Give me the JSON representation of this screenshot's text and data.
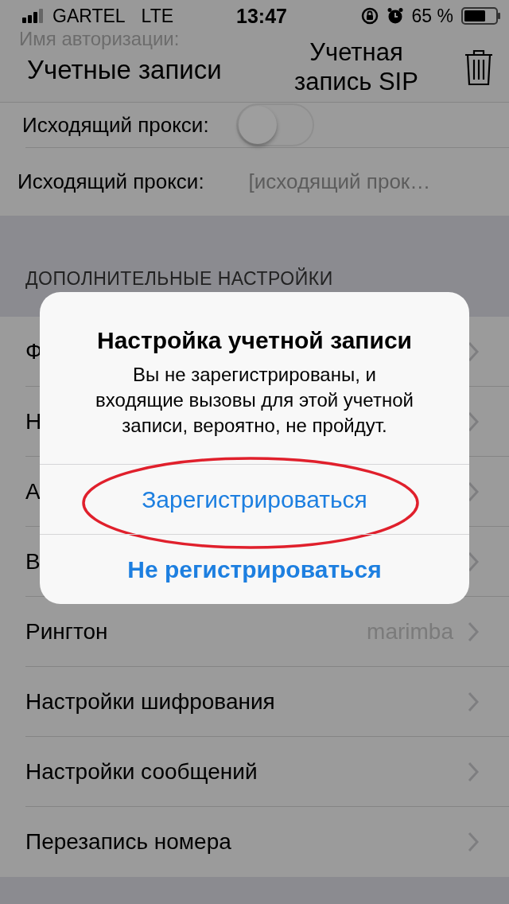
{
  "status_bar": {
    "carrier": "GARTEL",
    "network": "LTE",
    "time": "13:47",
    "battery": "65 %"
  },
  "nav_bar": {
    "back": "Учетные записи",
    "title": "Учетная запись SIP"
  },
  "behind_row": {
    "label": "Имя авторизации:"
  },
  "rows": [
    {
      "kind": "toggle",
      "label": "Исходящий прокси:",
      "on": false
    },
    {
      "kind": "field",
      "label": "Исходящий прокси:",
      "placeholder": "[исходящий прок…"
    }
  ],
  "section": {
    "header": "ДОПОЛНИТЕЛЬНЫЕ НАСТРОЙКИ",
    "rows": [
      {
        "label": "Ф"
      },
      {
        "label": "Н"
      },
      {
        "label": "А"
      },
      {
        "label": "В"
      },
      {
        "label": "Рингтон",
        "value": "marimba"
      },
      {
        "label": "Настройки шифрования"
      },
      {
        "label": "Настройки сообщений"
      },
      {
        "label": "Перезапись номера"
      }
    ]
  },
  "alert": {
    "title": "Настройка учетной записи",
    "message": "Вы не зарегистрированы, и входящие вызовы для этой учетной записи, вероятно, не пройдут.",
    "buttons": [
      {
        "label": "Зарегистрироваться",
        "bold": false,
        "circled": true
      },
      {
        "label": "Не регистрироваться",
        "bold": true,
        "circled": false
      }
    ]
  }
}
